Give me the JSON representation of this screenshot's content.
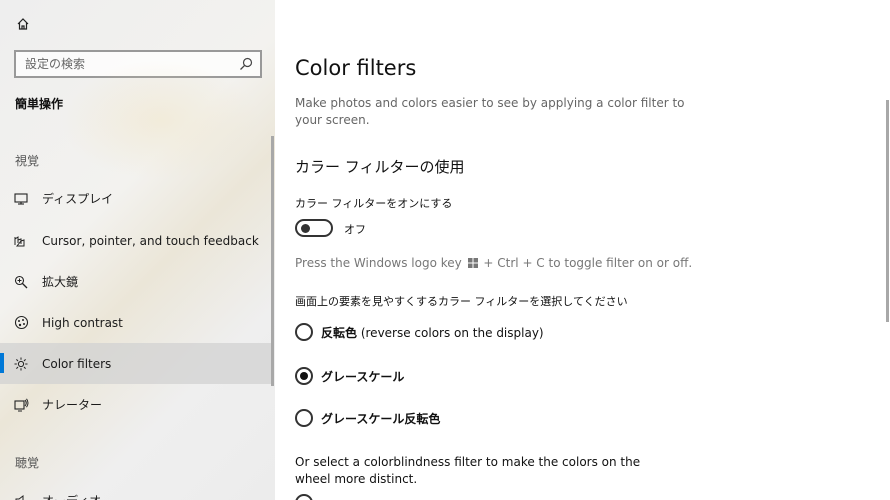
{
  "sidebar": {
    "search_placeholder": "設定の検索",
    "section_title": "簡単操作",
    "groups": [
      {
        "label": "視覚"
      },
      {
        "label": "聴覚"
      }
    ],
    "items": [
      {
        "label": "ディスプレイ",
        "icon": "monitor-icon"
      },
      {
        "label": "Cursor, pointer, and touch feedback",
        "icon": "pointer-icon"
      },
      {
        "label": "拡大鏡",
        "icon": "magnifier-icon"
      },
      {
        "label": "High contrast",
        "icon": "contrast-icon"
      },
      {
        "label": "Color filters",
        "icon": "sun-icon",
        "active": true
      },
      {
        "label": "ナレーター",
        "icon": "narrator-icon"
      },
      {
        "label": "オーディオ",
        "icon": "speaker-icon"
      }
    ]
  },
  "main": {
    "title": "Color filters",
    "description": "Make photos and colors easier to see by applying a color filter to your screen.",
    "section_heading": "カラー フィルターの使用",
    "toggle_label": "カラー フィルターをオンにする",
    "toggle_state_text": "オフ",
    "toggle_on": false,
    "hint_before": "Press the Windows logo key",
    "hint_after": "+ Ctrl + C to toggle filter on or off.",
    "choose_label": "画面上の要素を見やすくするカラー フィルターを選択してください",
    "options": [
      {
        "bold": "反転色",
        "rest": " (reverse colors on the display)",
        "checked": false
      },
      {
        "bold": "グレースケール",
        "rest": "",
        "checked": true
      },
      {
        "bold": "グレースケール反転色",
        "rest": "",
        "checked": false
      }
    ],
    "or_text": "Or select a colorblindness filter to make the colors on the wheel more distinct."
  },
  "colors": {
    "accent": "#0078d7"
  }
}
